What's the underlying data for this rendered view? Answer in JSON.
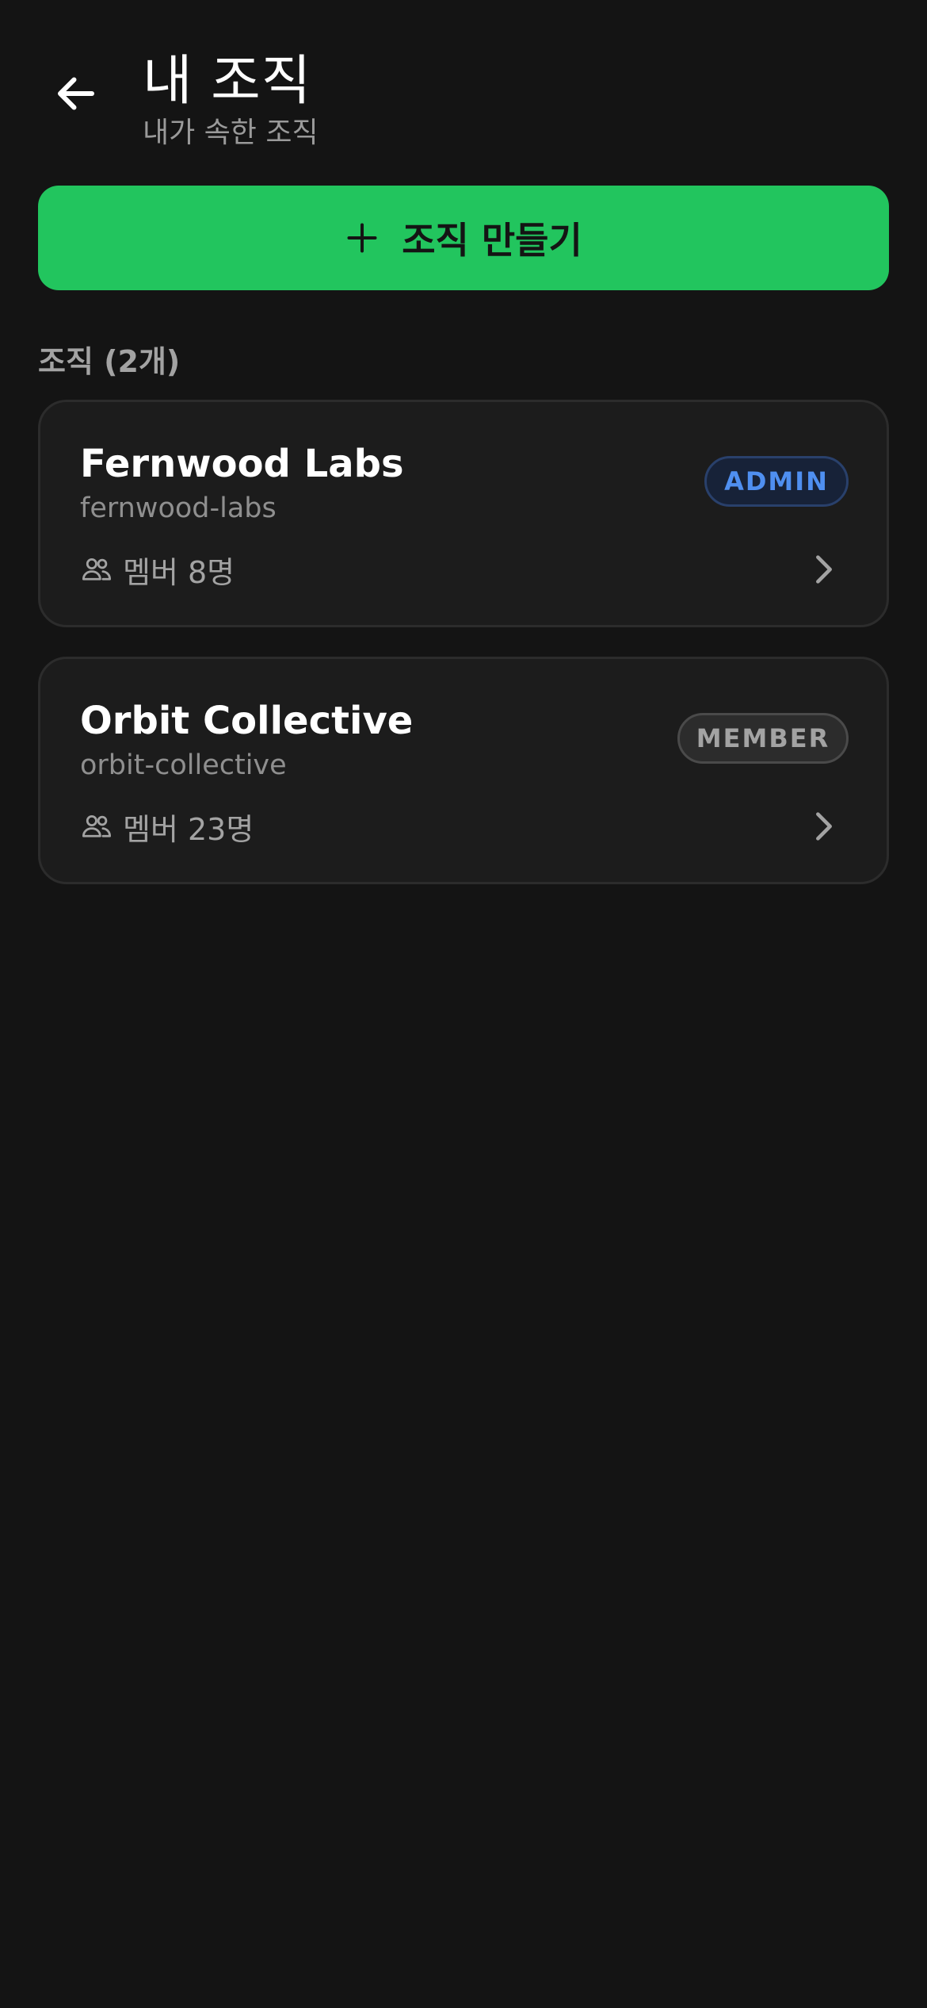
{
  "header": {
    "title": "내 조직",
    "subtitle": "내가 속한 조직",
    "back_icon": "arrow-left-icon"
  },
  "create_button": {
    "label": "조직 만들기",
    "icon": "plus-icon",
    "color": "#22c55e"
  },
  "section": {
    "label": "조직 (2개)"
  },
  "organizations": [
    {
      "name": "Fernwood Labs",
      "slug": "fernwood-labs",
      "members": "멤버 8명",
      "role": "ADMIN",
      "role_color": "#4f8ff0"
    },
    {
      "name": "Orbit Collective",
      "slug": "orbit-collective",
      "members": "멤버 23명",
      "role": "MEMBER",
      "role_color": "#a3a3a3"
    }
  ],
  "icons": {
    "members": "users-icon",
    "chevron": "chevron-right-icon"
  }
}
